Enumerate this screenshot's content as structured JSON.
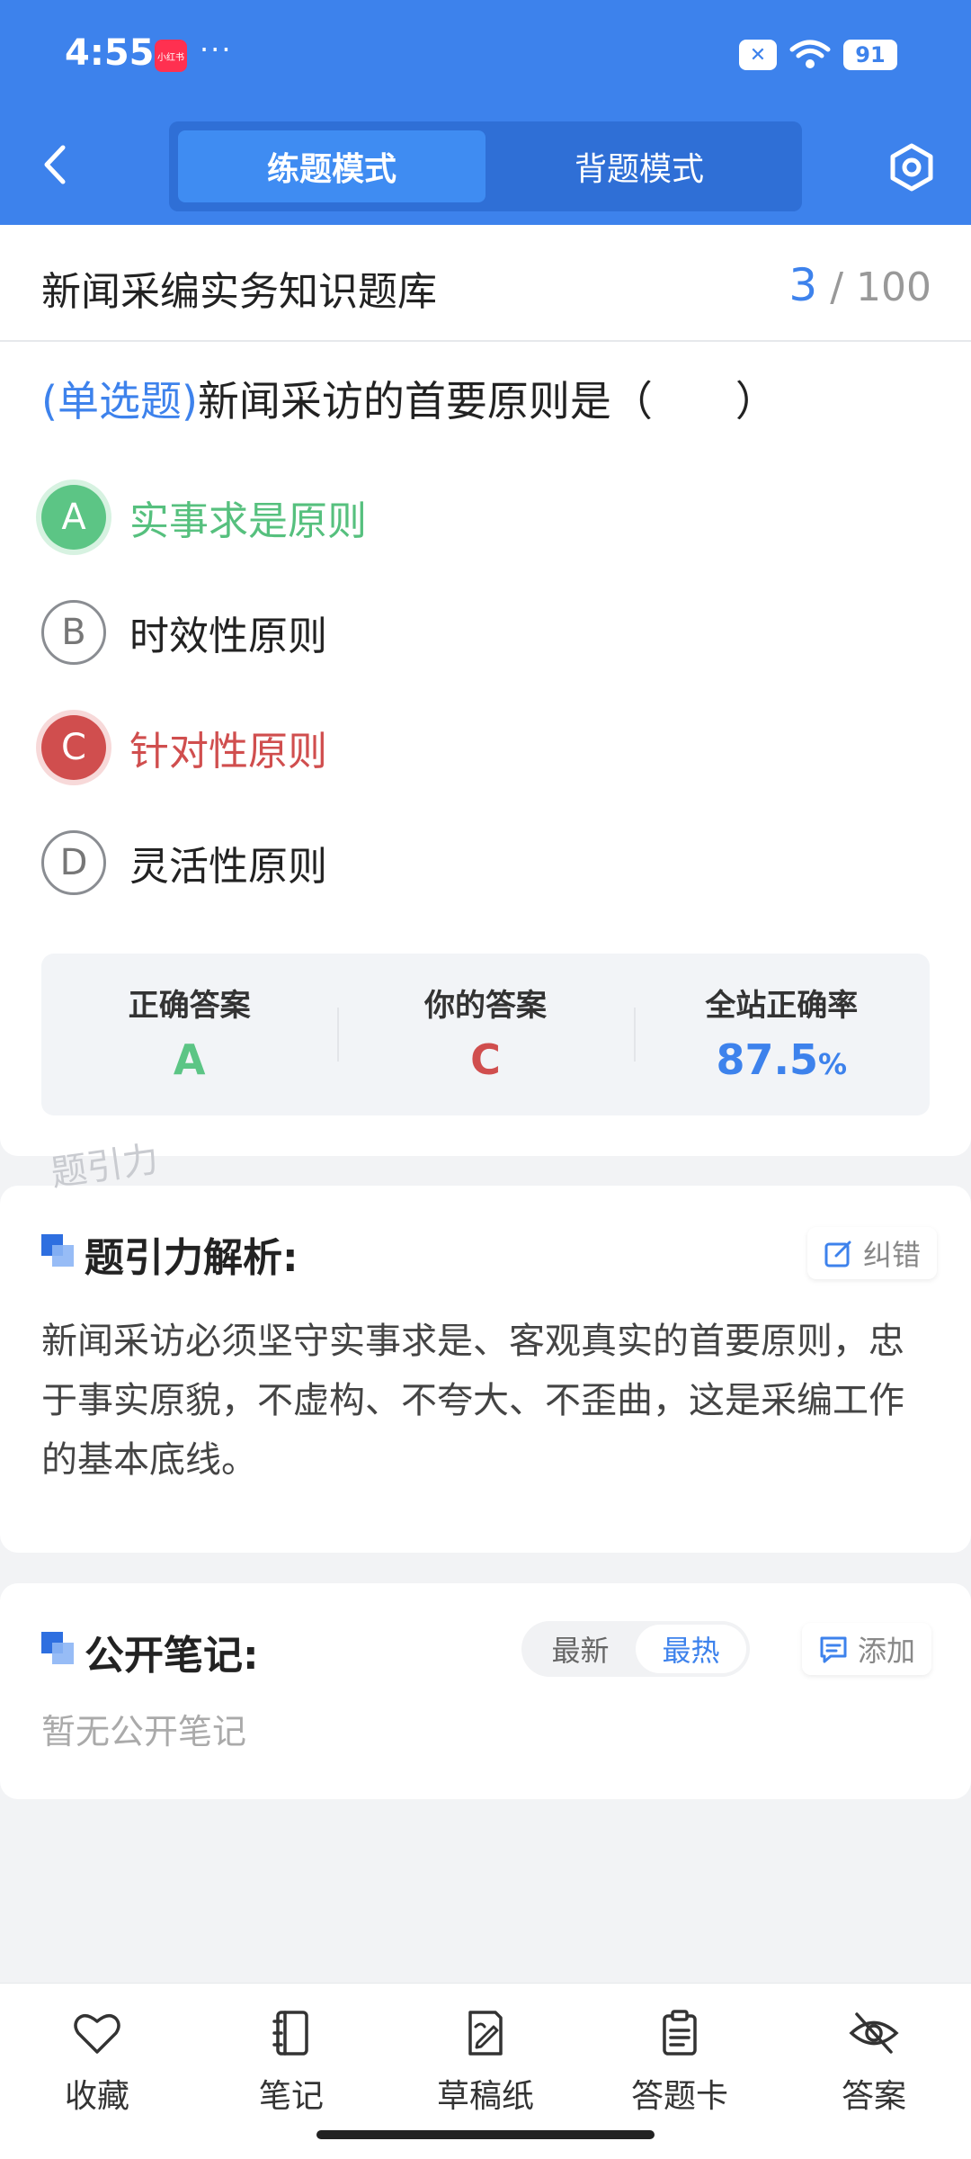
{
  "status_bar": {
    "time": "4:55",
    "app_badge": "小红书",
    "dots": "···",
    "battery": "91",
    "x_label": "✕"
  },
  "header": {
    "tabs": [
      {
        "label": "练题模式",
        "active": true
      },
      {
        "label": "背题模式",
        "active": false
      }
    ]
  },
  "title_bar": {
    "bank_title": "新闻采编实务知识题库",
    "current": "3",
    "separator": "/",
    "total": "100"
  },
  "question": {
    "type": "(单选题)",
    "text": "新闻采访的首要原则是（　　）",
    "options": [
      {
        "letter": "A",
        "text": "实事求是原则",
        "state": "correct"
      },
      {
        "letter": "B",
        "text": "时效性原则",
        "state": "normal"
      },
      {
        "letter": "C",
        "text": "针对性原则",
        "state": "wrong"
      },
      {
        "letter": "D",
        "text": "灵活性原则",
        "state": "normal"
      }
    ]
  },
  "stats": {
    "correct_label": "正确答案",
    "correct_value": "A",
    "yours_label": "你的答案",
    "yours_value": "C",
    "rate_label": "全站正确率",
    "rate_value": "87.5",
    "rate_unit": "%"
  },
  "watermark": "题引力",
  "analysis": {
    "title": "题引力解析:",
    "correct_btn": "纠错",
    "text": "新闻采访必须坚守实事求是、客观真实的首要原则，忠于事实原貌，不虚构、不夸大、不歪曲，这是采编工作的基本底线。"
  },
  "notes": {
    "title": "公开笔记:",
    "sort_latest": "最新",
    "sort_hot": "最热",
    "add_btn": "添加",
    "empty": "暂无公开笔记"
  },
  "bottom_bar": [
    {
      "label": "收藏",
      "icon": "heart-icon"
    },
    {
      "label": "笔记",
      "icon": "notebook-icon"
    },
    {
      "label": "草稿纸",
      "icon": "draft-icon"
    },
    {
      "label": "答题卡",
      "icon": "clipboard-icon"
    },
    {
      "label": "答案",
      "icon": "eye-off-icon"
    }
  ],
  "colors": {
    "primary": "#3d82ec",
    "correct": "#5cc585",
    "wrong": "#d04e4e"
  }
}
